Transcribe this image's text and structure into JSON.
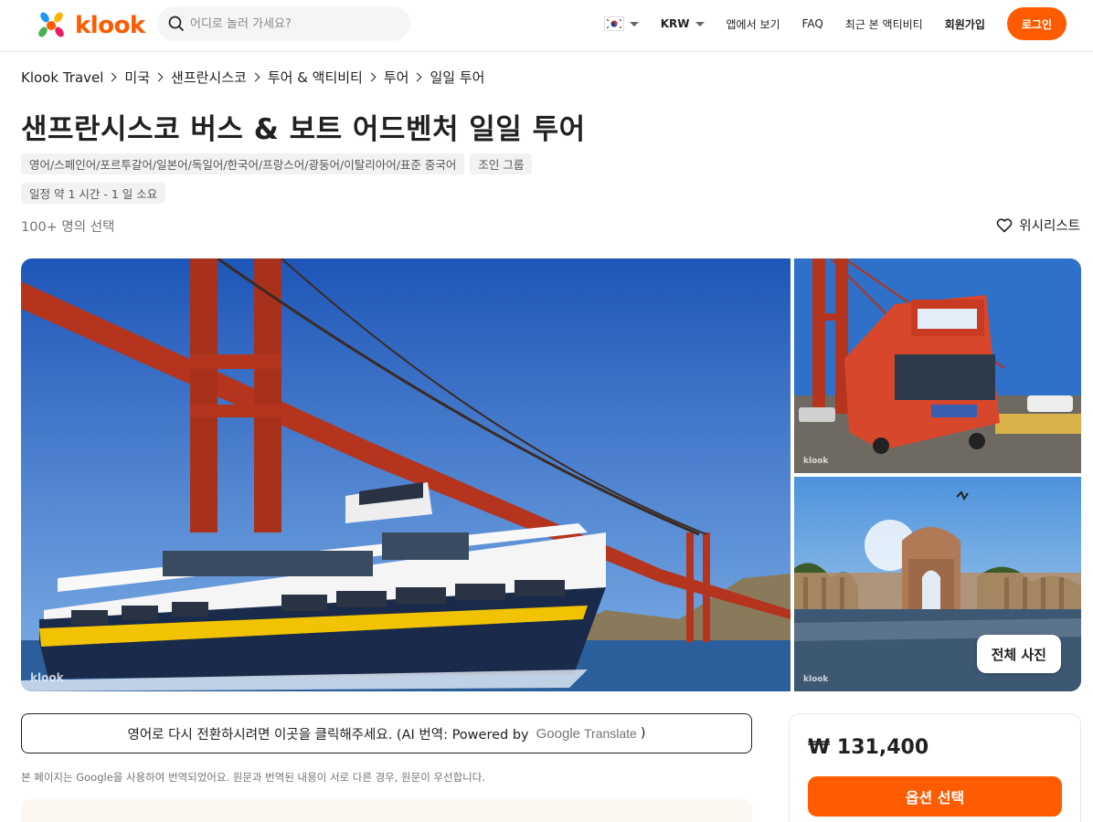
{
  "header": {
    "logo_text": "klook",
    "search_placeholder": "어디로 놀러 가세요?",
    "currency": "KRW",
    "nav": {
      "app": "앱에서 보기",
      "faq": "FAQ",
      "recent": "최근 본 액티비티",
      "signup": "회원가입",
      "login": "로그인"
    }
  },
  "breadcrumb": [
    "Klook Travel",
    "미국",
    "샌프란시스코",
    "투어 & 액티비티",
    "투어",
    "일일 투어"
  ],
  "activity": {
    "title": "샌프란시스코 버스 & 보트 어드벤처 일일 투어",
    "tags": {
      "languages": "영어/스페인어/포르투갈어/일본어/독일어/한국어/프랑스어/광둥어/이탈리아어/표준 중국어",
      "group": "조인 그룹",
      "duration": "일정 약 1 시간 - 1 일 소요"
    },
    "booked": "100+ 명의 선택",
    "wishlist": "위시리스트"
  },
  "gallery": {
    "watermark": "klook",
    "all_photos": "전체 사진"
  },
  "translate": {
    "message": "영어로 다시 전환하시려면 이곳을 클릭해주세요. (AI 번역: Powered by",
    "google": "Google",
    "translate_word": "Translate",
    "close_paren": ")",
    "disclaimer": "본 페이지는 Google을 사용하여 번역되었어요. 원문과 번역된 내용이 서로 다른 경우, 원문이 우선합니다."
  },
  "booking": {
    "price": "₩ 131,400",
    "select_button": "옵션 선택"
  },
  "colors": {
    "brand": "#ff5b00"
  }
}
